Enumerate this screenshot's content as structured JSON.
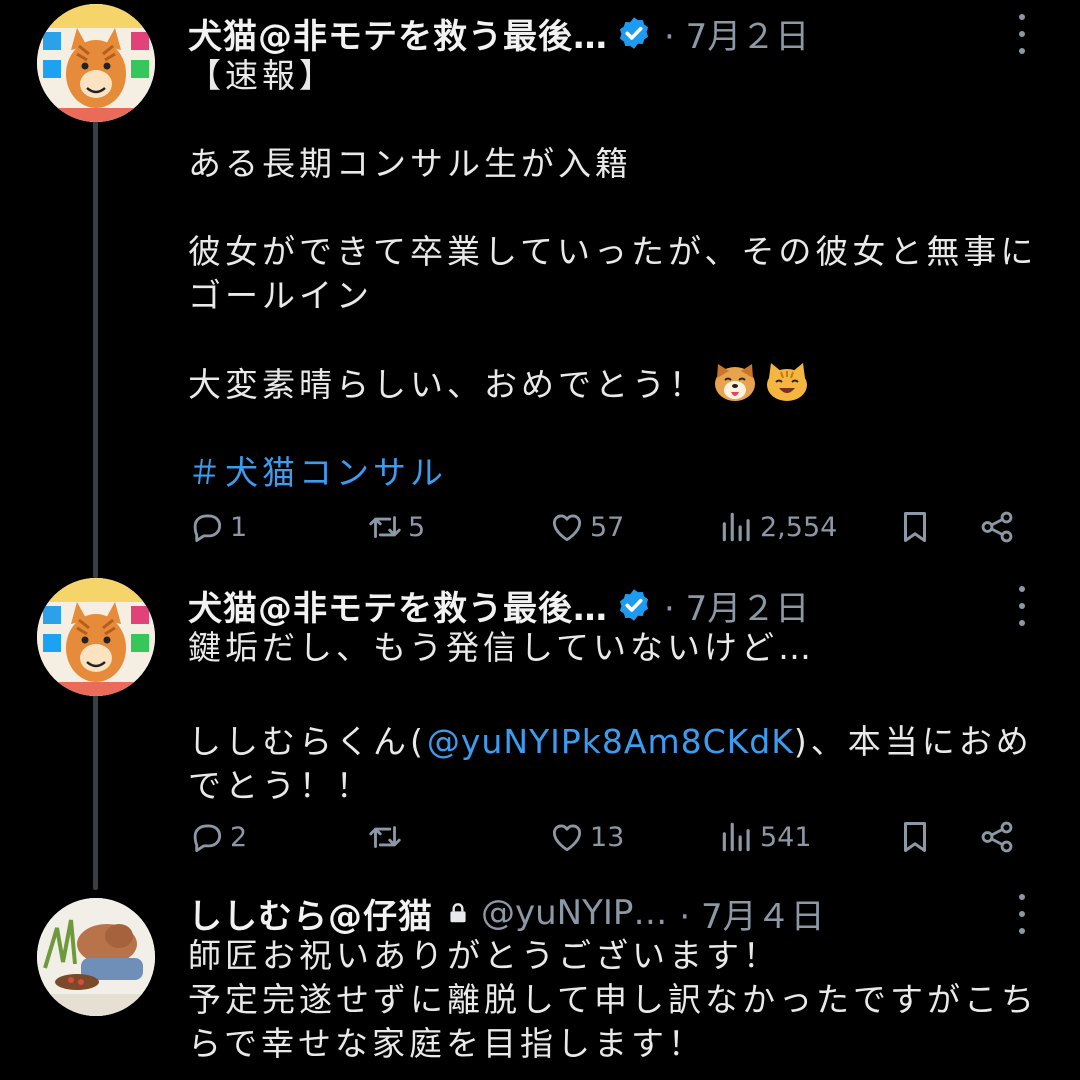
{
  "tweets": [
    {
      "name": "犬猫@非モテを救う最後…",
      "date": "· 7月２日",
      "avatar_icon": "cartoon-cat-avatar",
      "paragraphs": [
        "【速報】",
        "ある長期コンサル生が入籍",
        "彼女ができて卒業していったが、その彼女と無事にゴールイン",
        "大変素晴らしい、おめでとう！"
      ],
      "emojis": [
        "dog-face-emoji",
        "cat-face-emoji"
      ],
      "hashtag": "＃犬猫コンサル",
      "reply_count": "1",
      "retweet_count": "5",
      "like_count": "57",
      "view_count": "2,554"
    },
    {
      "name": "犬猫@非モテを救う最後…",
      "date": "· 7月２日",
      "avatar_icon": "cartoon-cat-avatar",
      "line1": "鍵垢だし、もう発信していないけど…",
      "line2_pre": "ししむらくん(",
      "mention": "@yuNYIPk8Am8CKdK",
      "line2_post": ")、本当におめでとう！！",
      "reply_count": "2",
      "retweet_count": "",
      "like_count": "13",
      "view_count": "541"
    },
    {
      "name": "ししむら@仔猫",
      "handle": "@yuNYIP…",
      "date": "· 7月４日",
      "avatar_icon": "person-photo-avatar",
      "line1": "師匠お祝いありがとうございます！",
      "line2": "予定完遂せずに離脱して申し訳なかったですがこちらで幸せな家庭を目指します！"
    }
  ],
  "colors": {
    "background": "#000000",
    "text": "#e7e9ea",
    "secondary": "#8b98a5",
    "link": "#3b9cf0",
    "verified": "#1d9bf0"
  }
}
